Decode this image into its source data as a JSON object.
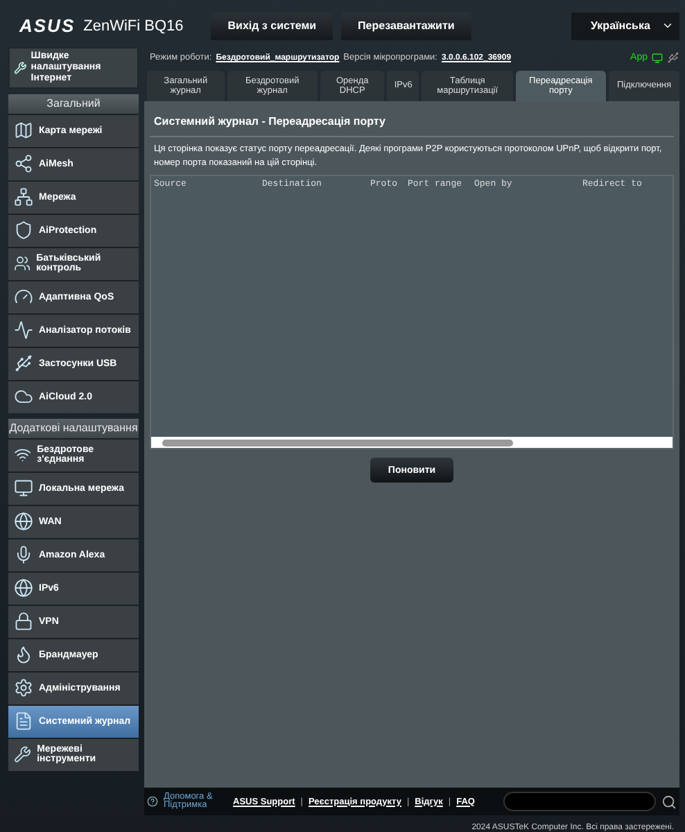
{
  "header": {
    "logo": "ASUS",
    "model": "ZenWiFi BQ16",
    "buttons": [
      {
        "label": "Вихід з системи"
      },
      {
        "label": "Перезавантажити"
      }
    ],
    "language": "Українська"
  },
  "sidebar": {
    "quick_setup": "Швидке налаштування Інтернет",
    "sections": [
      {
        "title": "Загальний",
        "items": [
          {
            "label": "Карта мережі",
            "selected": false
          },
          {
            "label": "AiMesh",
            "selected": false
          },
          {
            "label": "Мережа",
            "selected": false
          },
          {
            "label": "AiProtection",
            "selected": false
          },
          {
            "label": "Батьківський контроль",
            "selected": false
          },
          {
            "label": "Адаптивна QoS",
            "selected": false
          },
          {
            "label": "Аналізатор потоків",
            "selected": false
          },
          {
            "label": "Застосунки USB",
            "selected": false
          },
          {
            "label": "AiCloud 2.0",
            "selected": false
          }
        ]
      },
      {
        "title": "Додаткові налаштування",
        "items": [
          {
            "label": "Бездротове з'єднання",
            "selected": false
          },
          {
            "label": "Локальна мережа",
            "selected": false
          },
          {
            "label": "WAN",
            "selected": false
          },
          {
            "label": "Amazon Alexa",
            "selected": false
          },
          {
            "label": "IPv6",
            "selected": false
          },
          {
            "label": "VPN",
            "selected": false
          },
          {
            "label": "Брандмауер",
            "selected": false
          },
          {
            "label": "Адміністрування",
            "selected": false
          },
          {
            "label": "Системний журнал",
            "selected": true
          },
          {
            "label": "Мережеві інструменти",
            "selected": false
          }
        ]
      }
    ]
  },
  "status": {
    "mode_label": "Режим роботи:",
    "mode": "Бездротовий_маршрутизатор",
    "firmware_label": "Версія мікропрограми:",
    "firmware": "3.0.0.6.102_36909",
    "app": "App"
  },
  "tabs": [
    {
      "label": "Загальний журнал",
      "selected": false
    },
    {
      "label": "Бездротовий журнал",
      "selected": false
    },
    {
      "label": "Оренда DHCP",
      "selected": false
    },
    {
      "label": "IPv6",
      "selected": false
    },
    {
      "label": "Таблиця маршрутизації",
      "selected": false
    },
    {
      "label": "Переадресація порту",
      "selected": true
    },
    {
      "label": "Підключення",
      "selected": false
    }
  ],
  "panel": {
    "title": "Системний журнал - Переадресація порту",
    "description": "Ця сторінка показує статус порту переадресації. Деякі програми P2P користуються протоколом UPnP, щоб відкрити порт, номер порта показаний на цій сторінці.",
    "log_columns": [
      "Source",
      "Destination",
      "Proto",
      "Port range",
      "Open by",
      "Redirect to"
    ],
    "button": "Поновити"
  },
  "footer": {
    "help": "Допомога & Підтримка",
    "links": [
      "ASUS Support",
      "Реєстрація продукту",
      "Відгук",
      "FAQ"
    ],
    "separator": "|",
    "copyright": "2024 ASUSTeK Computer Inc. Всі права застережені."
  }
}
